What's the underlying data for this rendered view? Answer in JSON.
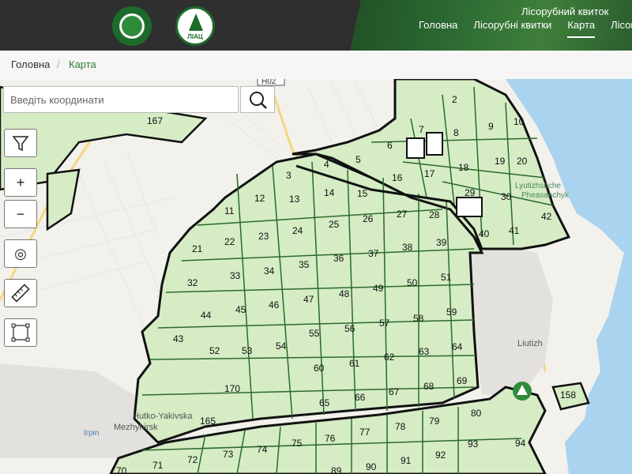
{
  "header": {
    "logos": [
      "forest-agency-emblem",
      "liac-emblem"
    ],
    "logo2_text": "ЛІАЦ",
    "site_title": "Лісорубний квиток",
    "nav": [
      "Головна",
      "Лісорубні квитки",
      "Карта",
      "Лісові"
    ],
    "active_nav": "Карта"
  },
  "breadcrumb": {
    "home": "Головна",
    "separator": "/",
    "current": "Карта"
  },
  "search": {
    "placeholder": "Введіть координати",
    "value": ""
  },
  "tools": {
    "filter": "filter-icon",
    "zoom_in": "+",
    "zoom_out": "−",
    "locate": "◎",
    "measure": "ruler-icon",
    "select": "select-area-icon"
  },
  "map": {
    "place_labels": [
      "Liutizh",
      "Hutko-Yakivska",
      "Mezhyhirsk",
      "Irpin",
      "Lyutizhshche",
      "Pheasanchyk"
    ],
    "road_label": "Н02",
    "plot_numbers": [
      "2",
      "7",
      "8",
      "9",
      "10",
      "6",
      "4",
      "5",
      "3",
      "16",
      "17",
      "18",
      "19",
      "20",
      "29",
      "30",
      "42",
      "40",
      "41",
      "12",
      "13",
      "14",
      "15",
      "26",
      "27",
      "28",
      "11",
      "22",
      "23",
      "24",
      "25",
      "38",
      "39",
      "21",
      "36",
      "37",
      "33",
      "34",
      "35",
      "50",
      "51",
      "32",
      "46",
      "47",
      "48",
      "49",
      "58",
      "59",
      "44",
      "45",
      "56",
      "57",
      "43",
      "52",
      "53",
      "54",
      "55",
      "62",
      "63",
      "64",
      "60",
      "61",
      "65",
      "66",
      "67",
      "68",
      "69",
      "170",
      "165",
      "77",
      "78",
      "79",
      "80",
      "76",
      "75",
      "74",
      "73",
      "72",
      "71",
      "70",
      "89",
      "90",
      "91",
      "92",
      "93",
      "94",
      "158",
      "167"
    ],
    "colors": {
      "plot_fill": "#d5ecc5",
      "plot_border": "#2b6a2b",
      "outline": "#111111",
      "water": "#a9d3ee"
    }
  }
}
